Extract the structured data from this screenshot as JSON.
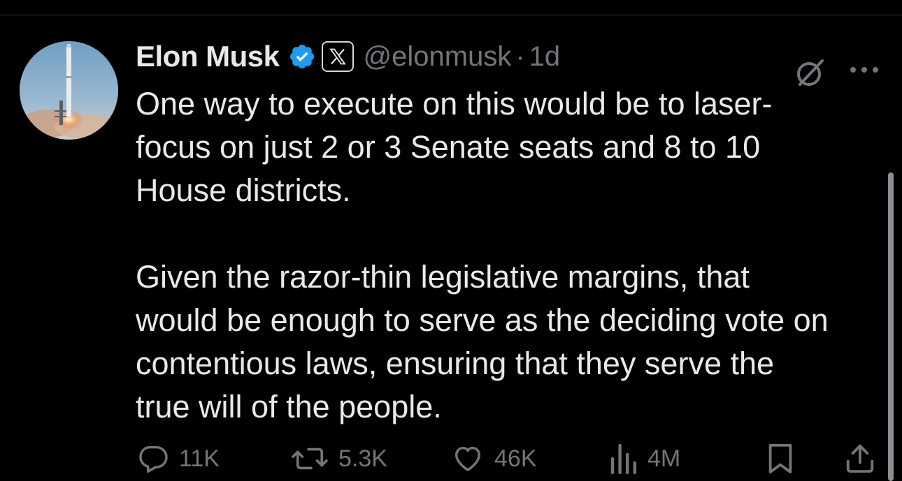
{
  "tweet": {
    "author": {
      "display_name": "Elon Musk",
      "handle": "@elonmusk",
      "verified": true,
      "affiliate_badge": "x-logo-icon"
    },
    "separator": "·",
    "timestamp": "1d",
    "lines": [
      "One way to execute on this would be to laser-",
      "focus on just 2 or 3 Senate seats and 8 to 10",
      "House districts.",
      "Given the razor-thin legislative margins, that",
      "would be enough to serve as the deciding vote on",
      "contentious laws, ensuring that they serve the",
      "true will of the people."
    ],
    "actions": {
      "replies": "11K",
      "reposts": "5.3K",
      "likes": "46K",
      "views": "4M"
    }
  },
  "colors": {
    "background": "#000000",
    "primary_text": "#e7e9ea",
    "secondary_text": "#71767b",
    "verified_blue": "#1d9bf0",
    "divider": "#2f3336"
  }
}
